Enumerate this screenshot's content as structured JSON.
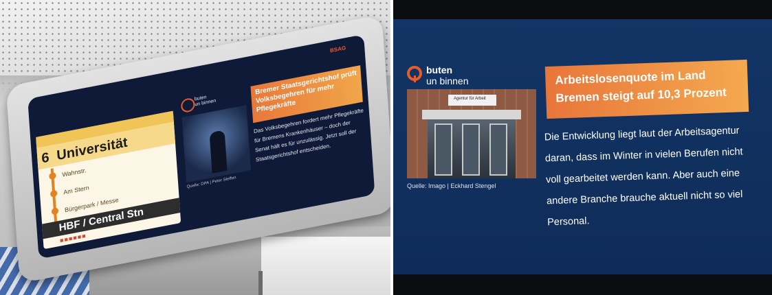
{
  "left_display": {
    "route": {
      "line_number": "6",
      "destination": "Universität",
      "stops": [
        "Wahnstr.",
        "Am Stern",
        "Bürgerpark / Messe"
      ],
      "terminus": "HBF / Central Stn",
      "brand": "BSAG"
    },
    "news": {
      "logo_text_line1": "buten",
      "logo_text_line2": "un binnen",
      "headline": "Bremer Staatsgerichtshof prüft Volksbegehren für mehr Pflegekräfte",
      "body": "Das Volksbegehren fordert mehr Pflegekräfte für Bremens Krankenhäuser – doch der Senat hält es für unzulässig. Jetzt soll der Staatsgerichtshof entscheiden.",
      "caption": "Quelle: DPA | Peter Steffen"
    }
  },
  "right_display": {
    "logo_text_line1": "buten",
    "logo_text_line2": "un binnen",
    "photo_sign": "Agentur für Arbeit",
    "caption": "Quelle: Imago | Eckhard Stengel",
    "headline": "Arbeitslosenquote im Land Bremen steigt auf 10,3 Prozent",
    "body": "Die Entwicklung liegt laut der Arbeitsagentur daran, dass im Winter in vielen Berufen nicht voll gearbeitet werden kann. Aber auch eine andere Branche brauche aktuell nicht so viel Personal."
  },
  "colors": {
    "headline_orange": "#ee8a3f",
    "screen_blue": "#123566",
    "route_yellow": "#f6d98a",
    "logo_orange": "#e85c2a"
  }
}
